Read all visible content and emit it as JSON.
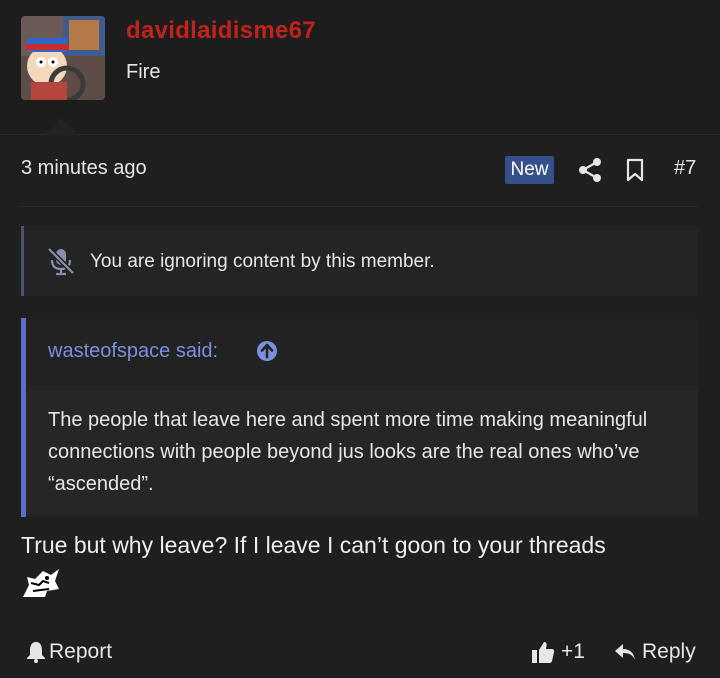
{
  "post": {
    "username": "davidlaidisme67",
    "user_title": "Fire",
    "timestamp": "3 minutes ago",
    "new_badge": "New",
    "post_number": "#7",
    "ignored_notice": "You are ignoring content by this member.",
    "quote": {
      "author_label": "wasteofspace said:",
      "text": "The people that leave here and spent more time making meaningful connections with people beyond jus looks are the real ones who’ve “ascended”."
    },
    "body": "True but why leave? If I leave I can’t goon to your threads",
    "actions": {
      "report_label": "Report",
      "like_count": "+1",
      "reply_label": "Reply"
    }
  },
  "colors": {
    "background": "#1f1f1f",
    "username": "#c1221b",
    "new_badge": "#35508a",
    "quote_accent": "#5a6ed0",
    "quote_author": "#7b8fe0"
  },
  "icons": [
    "share-icon",
    "bookmark-icon",
    "muted-microphone-icon",
    "arrow-up-circle-icon",
    "bell-icon",
    "thumbs-up-icon",
    "reply-arrow-icon"
  ]
}
